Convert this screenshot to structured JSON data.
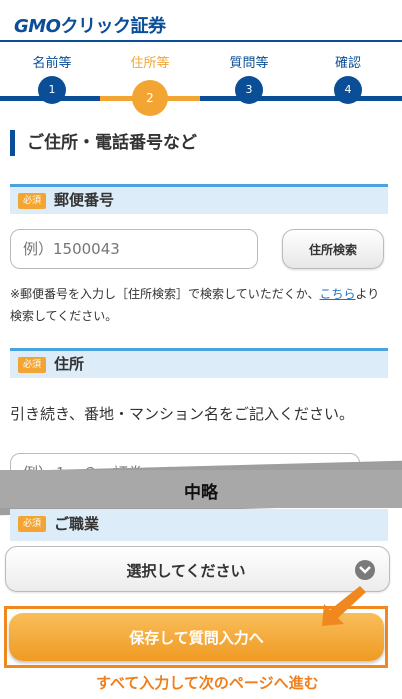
{
  "header": {
    "logo_gmo": "GMO",
    "logo_rest": "クリック証券"
  },
  "steps": [
    {
      "label": "名前等",
      "number": "1"
    },
    {
      "label": "住所等",
      "number": "2"
    },
    {
      "label": "質問等",
      "number": "3"
    },
    {
      "label": "確認",
      "number": "4"
    }
  ],
  "section_title": "ご住所・電話番号など",
  "required_badge": "必須",
  "postal": {
    "title": "郵便番号",
    "placeholder": "例）1500043",
    "search_button": "住所検索",
    "note_prefix": "※郵便番号を入力し［住所検索］で検索していただくか、",
    "note_link": "こちら",
    "note_suffix": "より検索してください。"
  },
  "address": {
    "title": "住所",
    "description": "引き続き、番地・マンション名をご記入ください。",
    "placeholder": "例）１－３　証券ハイツ101"
  },
  "omitted_label": "中略",
  "occupation": {
    "title": "ご職業",
    "select_value": "選択してください"
  },
  "save_button": "保存して質問入力へ",
  "callout": "すべて入力して次のページへ進む",
  "colors": {
    "primary": "#0a4e97",
    "accent": "#f3a534",
    "highlight": "#f0881f"
  }
}
